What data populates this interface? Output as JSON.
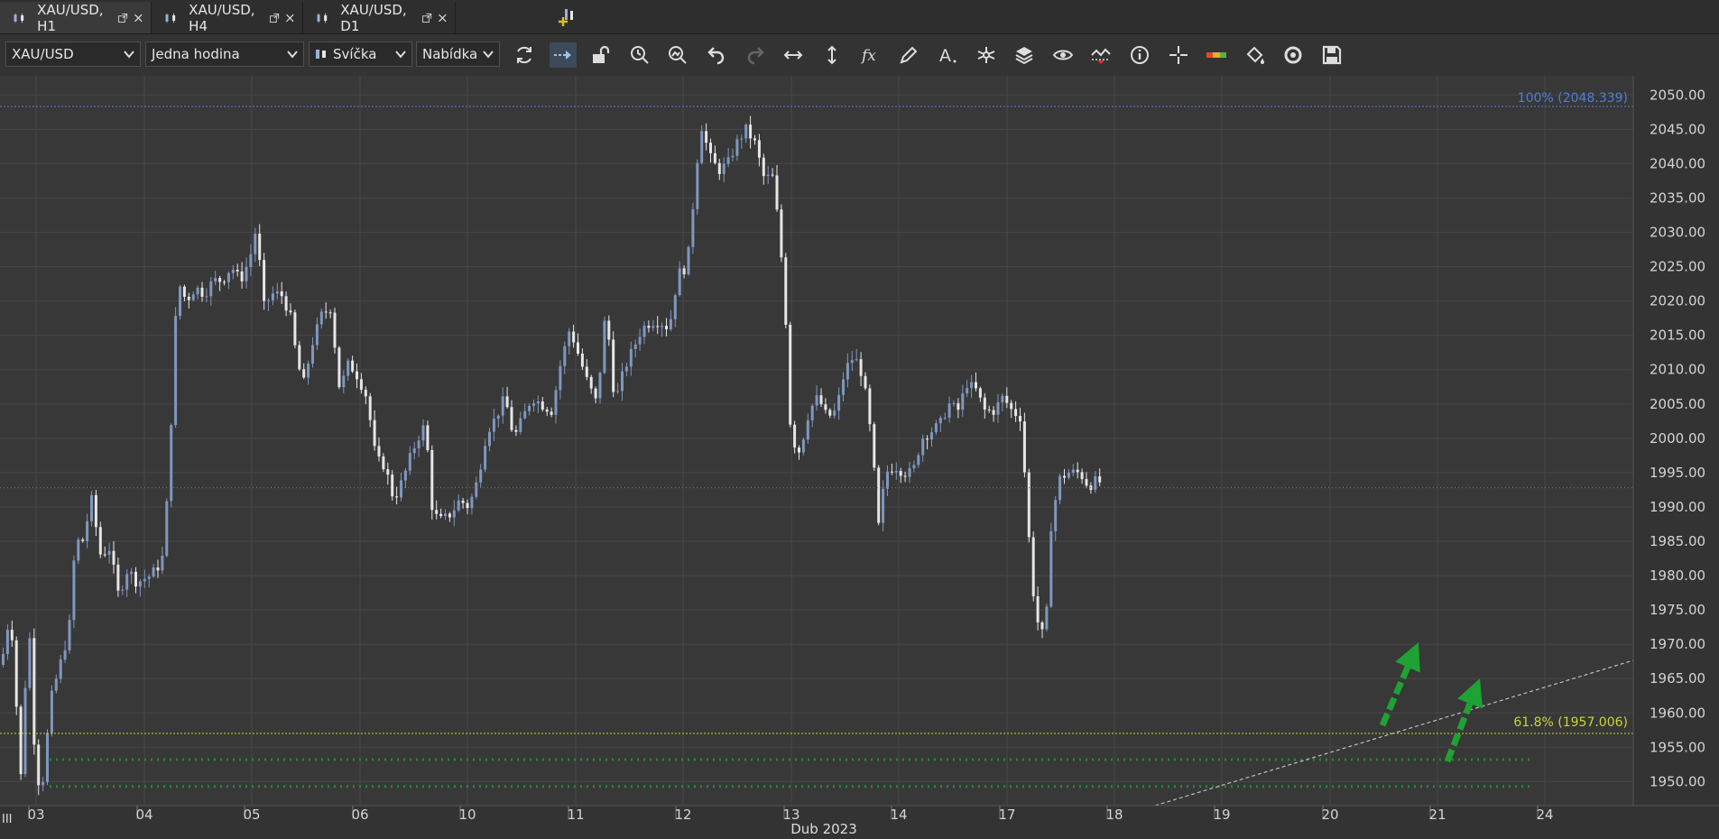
{
  "tabs": [
    {
      "label": "XAU/USD, H1",
      "active": true
    },
    {
      "label": "XAU/USD, H4",
      "active": false
    },
    {
      "label": "XAU/USD, D1",
      "active": false
    }
  ],
  "toolbar": {
    "instrument": "XAU/USD",
    "period": "Jedna hodina",
    "chart_type": "Svíčka",
    "price_side": "Nabídka",
    "tools": [
      "refresh-icon",
      "scroll-right-icon",
      "unlock-icon",
      "zoom-time-icon",
      "zoom-magnifier-icon",
      "undo-icon",
      "redo-icon",
      "horizontal-arrows-icon",
      "vertical-arrows-icon",
      "indicator-fx-icon",
      "pencil-icon",
      "text-tool-icon",
      "pattern-icon",
      "layers-icon",
      "eye-icon",
      "chart-compare-icon",
      "info-icon",
      "crosshair-icon",
      "signal-bar-icon",
      "paint-bucket-icon",
      "reset-icon",
      "save-icon"
    ]
  },
  "chart": {
    "current_price_label": "1992.805",
    "fib_100_label": "100% (2048.339)",
    "fib_618_label": "61.8% (1957.006)",
    "date_caption": "Dub 2023",
    "corner_label": "III",
    "colors": {
      "up": "#7f97bf",
      "down": "#e6e6e6",
      "fib100": "#4f7fd4",
      "fib618": "#c8d43a",
      "support": "#1f8c2e",
      "arrow": "#1fa233",
      "trend": "#bfbfbf",
      "price_tag": "#7f9ec6",
      "bg": "#383838",
      "grid": "#474747"
    }
  },
  "chart_data": {
    "type": "candlestick",
    "instrument": "XAU/USD",
    "timeframe": "H1",
    "y_ticks": [
      "2050.00",
      "2045.00",
      "2040.00",
      "2035.00",
      "2030.00",
      "2025.00",
      "2020.00",
      "2015.00",
      "2010.00",
      "2005.00",
      "2000.00",
      "1995.00",
      "1990.00",
      "1985.00",
      "1980.00",
      "1975.00",
      "1970.00",
      "1965.00",
      "1960.00",
      "1955.00",
      "1950.00"
    ],
    "ylim": [
      1946.5,
      2052.8
    ],
    "x_ticks": [
      "03",
      "04",
      "05",
      "06",
      "10",
      "11",
      "12",
      "13",
      "14",
      "17",
      "18",
      "19",
      "20",
      "21",
      "24"
    ],
    "current_price": 1992.805,
    "fib_levels": [
      {
        "label": "100%",
        "value": 2048.339
      },
      {
        "label": "61.8%",
        "value": 1957.006
      }
    ],
    "support_levels": [
      1953.2,
      1949.3
    ],
    "path": [
      [
        0,
        1967
      ],
      [
        10,
        1975
      ],
      [
        22,
        1950
      ],
      [
        30,
        1975
      ],
      [
        38,
        1951
      ],
      [
        45,
        1949
      ],
      [
        55,
        1962
      ],
      [
        65,
        1967
      ],
      [
        75,
        1972
      ],
      [
        82,
        1985
      ],
      [
        90,
        1985
      ],
      [
        100,
        1991
      ],
      [
        110,
        1983
      ],
      [
        120,
        1984
      ],
      [
        130,
        1977
      ],
      [
        140,
        1981
      ],
      [
        150,
        1979
      ],
      [
        165,
        1980
      ],
      [
        178,
        1982
      ],
      [
        185,
        1993
      ],
      [
        195,
        2023
      ],
      [
        205,
        2020
      ],
      [
        215,
        2022
      ],
      [
        225,
        2021
      ],
      [
        235,
        2023
      ],
      [
        245,
        2023
      ],
      [
        255,
        2025
      ],
      [
        265,
        2023
      ],
      [
        275,
        2026
      ],
      [
        283,
        2031
      ],
      [
        290,
        2019
      ],
      [
        300,
        2021
      ],
      [
        310,
        2021
      ],
      [
        320,
        2018
      ],
      [
        328,
        2011
      ],
      [
        335,
        2008
      ],
      [
        345,
        2014
      ],
      [
        355,
        2018
      ],
      [
        365,
        2019
      ],
      [
        375,
        2007
      ],
      [
        385,
        2011
      ],
      [
        395,
        2009
      ],
      [
        405,
        2006
      ],
      [
        415,
        1997
      ],
      [
        425,
        1996
      ],
      [
        435,
        1991
      ],
      [
        445,
        1994
      ],
      [
        455,
        1998
      ],
      [
        465,
        2001
      ],
      [
        470,
        2002
      ],
      [
        478,
        1989
      ],
      [
        488,
        1988
      ],
      [
        498,
        1989
      ],
      [
        508,
        1991
      ],
      [
        518,
        1990
      ],
      [
        528,
        1994
      ],
      [
        538,
        2001
      ],
      [
        548,
        2003
      ],
      [
        558,
        2006
      ],
      [
        568,
        2000
      ],
      [
        578,
        2003
      ],
      [
        588,
        2006
      ],
      [
        598,
        2005
      ],
      [
        610,
        2004
      ],
      [
        620,
        2011
      ],
      [
        630,
        2016
      ],
      [
        640,
        2012
      ],
      [
        650,
        2008
      ],
      [
        660,
        2005
      ],
      [
        670,
        2019
      ],
      [
        680,
        2005
      ],
      [
        690,
        2010
      ],
      [
        700,
        2013
      ],
      [
        710,
        2016
      ],
      [
        720,
        2017
      ],
      [
        730,
        2017
      ],
      [
        740,
        2016
      ],
      [
        750,
        2024
      ],
      [
        760,
        2025
      ],
      [
        768,
        2036
      ],
      [
        775,
        2046
      ],
      [
        785,
        2041
      ],
      [
        795,
        2039
      ],
      [
        805,
        2040
      ],
      [
        815,
        2043
      ],
      [
        825,
        2045
      ],
      [
        835,
        2043
      ],
      [
        845,
        2038
      ],
      [
        855,
        2038
      ],
      [
        862,
        2030
      ],
      [
        868,
        2021
      ],
      [
        875,
        2000
      ],
      [
        885,
        1998
      ],
      [
        895,
        2004
      ],
      [
        905,
        2006
      ],
      [
        915,
        2003
      ],
      [
        925,
        2004
      ],
      [
        935,
        2010
      ],
      [
        945,
        2012
      ],
      [
        955,
        2009
      ],
      [
        965,
        1999
      ],
      [
        972,
        1987
      ],
      [
        980,
        1995
      ],
      [
        990,
        1996
      ],
      [
        1000,
        1995
      ],
      [
        1010,
        1995
      ],
      [
        1020,
        2000
      ],
      [
        1030,
        2001
      ],
      [
        1040,
        2002
      ],
      [
        1050,
        2005
      ],
      [
        1060,
        2004
      ],
      [
        1070,
        2008
      ],
      [
        1080,
        2007
      ],
      [
        1090,
        2004
      ],
      [
        1100,
        2004
      ],
      [
        1110,
        2006
      ],
      [
        1120,
        2004
      ],
      [
        1130,
        2003
      ],
      [
        1135,
        1993
      ],
      [
        1142,
        1979
      ],
      [
        1150,
        1972
      ],
      [
        1157,
        1971
      ],
      [
        1163,
        1987
      ],
      [
        1172,
        1994
      ],
      [
        1182,
        1995
      ],
      [
        1195,
        1995
      ],
      [
        1205,
        1993
      ],
      [
        1215,
        1994
      ],
      [
        1222,
        1992.8
      ]
    ]
  }
}
